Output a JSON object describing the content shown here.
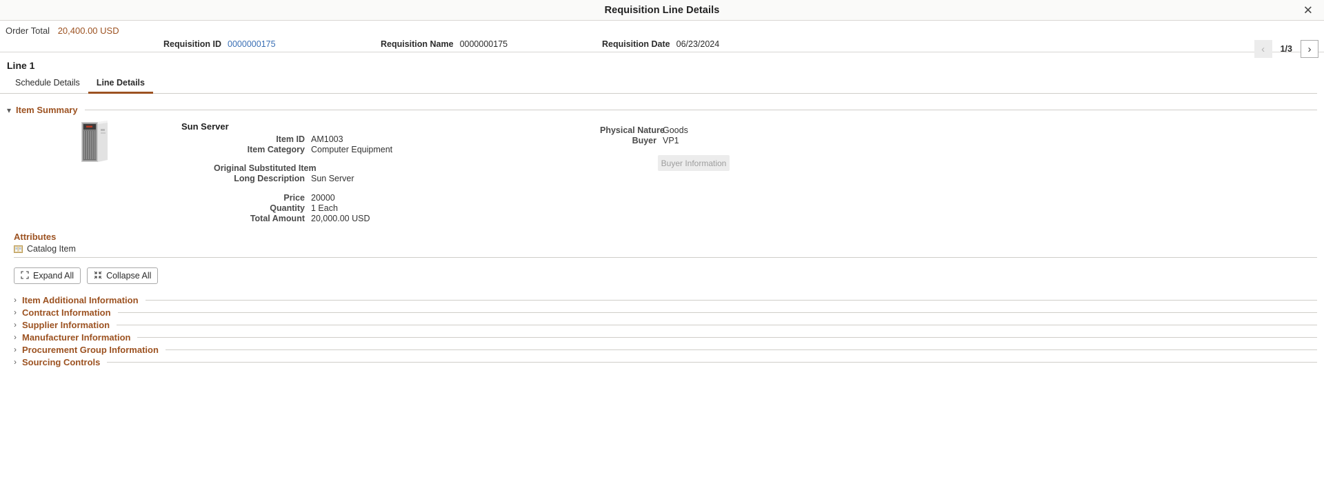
{
  "modal": {
    "title": "Requisition Line Details",
    "close_icon": "close-icon"
  },
  "header": {
    "order_total_label": "Order Total",
    "order_total_value": "20,400.00 USD",
    "fields": [
      {
        "label": "Requisition ID",
        "value": "0000000175",
        "is_link": true
      },
      {
        "label": "Requisition Name",
        "value": "0000000175",
        "is_link": false
      },
      {
        "label": "Requisition Date",
        "value": "06/23/2024",
        "is_link": false
      }
    ],
    "pager": {
      "prev_icon": "chevron-left-icon",
      "next_icon": "chevron-right-icon",
      "count": "1/3"
    }
  },
  "line": {
    "heading": "Line 1",
    "tabs": [
      {
        "label": "Schedule Details",
        "active": false
      },
      {
        "label": "Line Details",
        "active": true
      }
    ]
  },
  "item_summary": {
    "section_title": "Item Summary",
    "caret_icon": "chevron-down-icon",
    "item_name": "Sun Server",
    "thumbnail_icon": "server-rack-image",
    "left_fields_a": [
      {
        "label": "Item ID",
        "value": "AM1003"
      },
      {
        "label": "Item Category",
        "value": "Computer Equipment"
      }
    ],
    "left_fields_b": [
      {
        "label": "Original Substituted Item",
        "value": ""
      },
      {
        "label": "Long Description",
        "value": "Sun Server"
      }
    ],
    "left_fields_c": [
      {
        "label": "Price",
        "value": "20000"
      },
      {
        "label": "Quantity",
        "value": "1 Each"
      },
      {
        "label": "Total Amount",
        "value": "20,000.00 USD"
      }
    ],
    "right_fields": [
      {
        "label": "Physical Nature",
        "value": "Goods"
      },
      {
        "label": "Buyer",
        "value": "VP1"
      }
    ],
    "buyer_information_button": "Buyer Information"
  },
  "attributes": {
    "title": "Attributes",
    "items": [
      {
        "label": "Catalog Item",
        "icon": "catalog-item-icon"
      }
    ]
  },
  "toolbar": {
    "expand_all_label": "Expand All",
    "expand_all_icon": "expand-all-icon",
    "collapse_all_label": "Collapse All",
    "collapse_all_icon": "collapse-all-icon"
  },
  "collapsed_sections": [
    {
      "label": "Item Additional Information",
      "caret_icon": "chevron-right-icon"
    },
    {
      "label": "Contract Information",
      "caret_icon": "chevron-right-icon"
    },
    {
      "label": "Supplier Information",
      "caret_icon": "chevron-right-icon"
    },
    {
      "label": "Manufacturer Information",
      "caret_icon": "chevron-right-icon"
    },
    {
      "label": "Procurement Group Information",
      "caret_icon": "chevron-right-icon"
    },
    {
      "label": "Sourcing Controls",
      "caret_icon": "chevron-right-icon"
    }
  ],
  "colors": {
    "accent": "#9c5221",
    "link": "#3a6fb5",
    "rule": "#cfcdc8"
  }
}
